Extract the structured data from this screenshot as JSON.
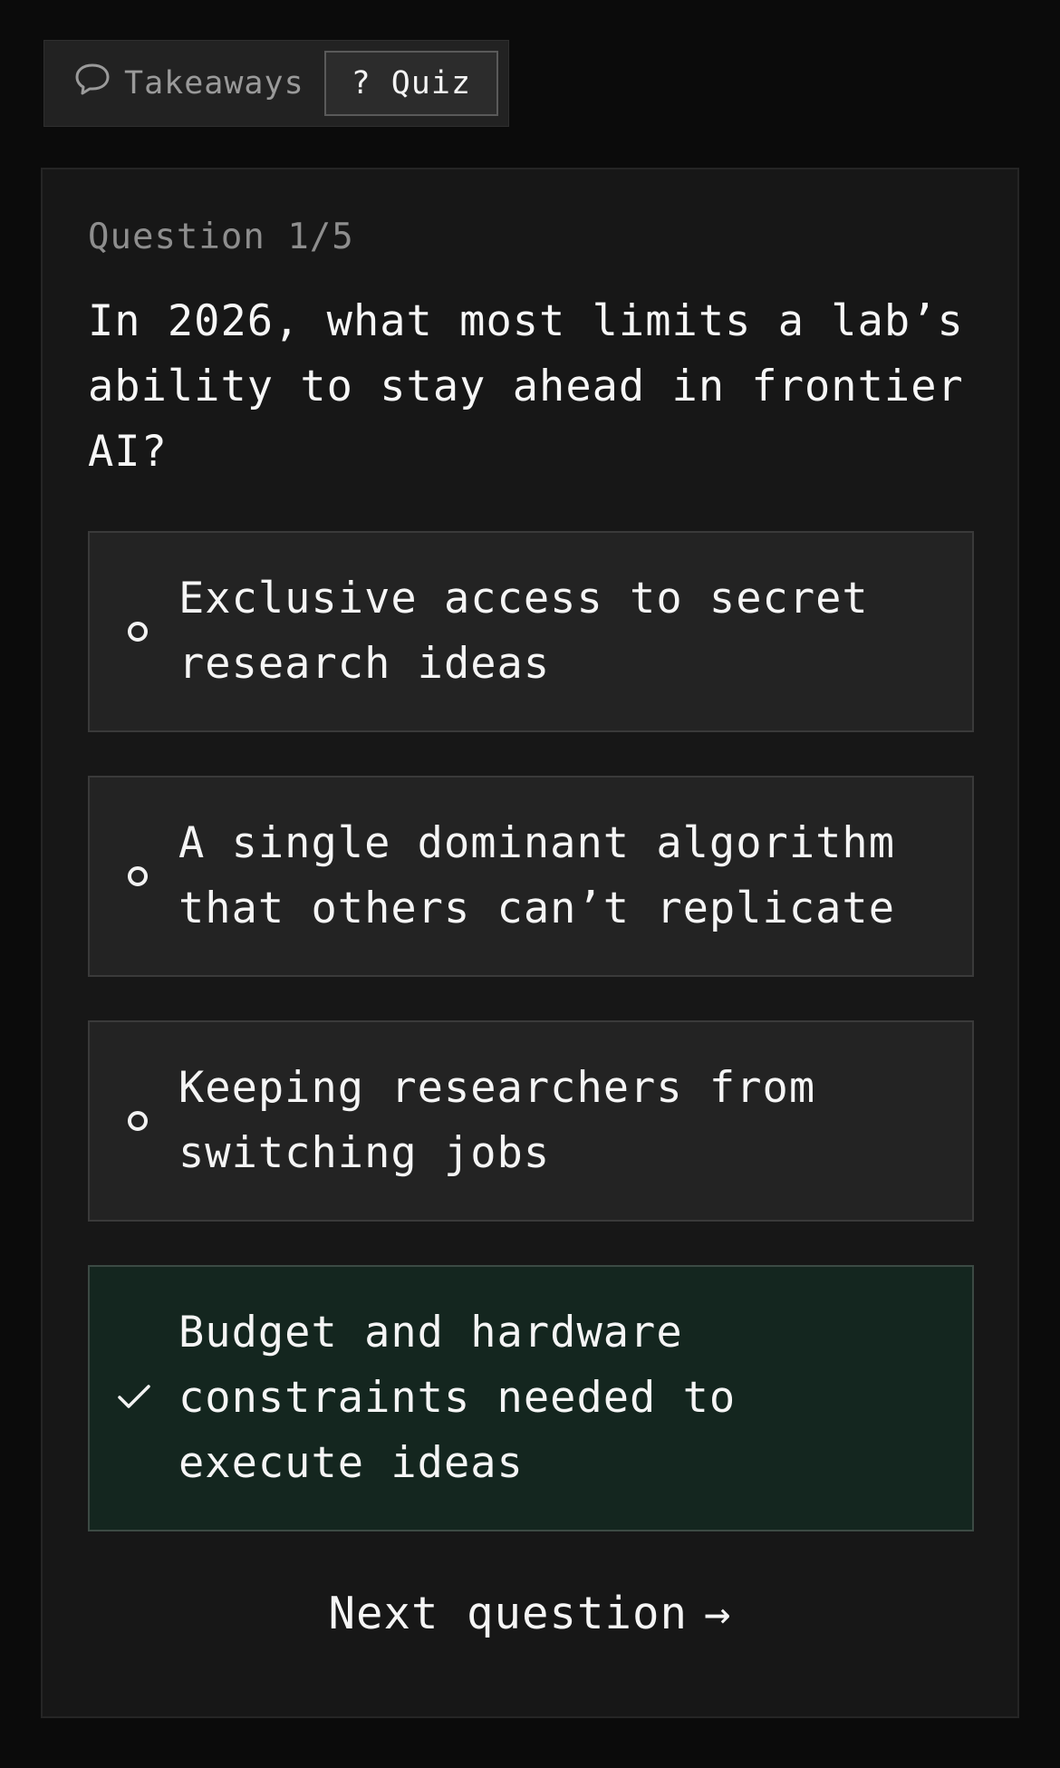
{
  "tabs": {
    "takeaways_label": "Takeaways",
    "quiz_label": "Quiz",
    "quiz_glyph": "?",
    "active": "Quiz"
  },
  "quiz": {
    "counter": "Question 1/5",
    "question": "In 2026, what most limits a lab’s ability to stay ahead in frontier AI?",
    "options": [
      {
        "text": "Exclusive access to secret research ideas",
        "state": "unselected"
      },
      {
        "text": "A single dominant algorithm that others can’t replicate",
        "state": "unselected"
      },
      {
        "text": "Keeping researchers from switching jobs",
        "state": "unselected"
      },
      {
        "text": "Budget and hardware constraints needed to execute ideas",
        "state": "correct"
      }
    ],
    "next_label": "Next question",
    "next_arrow": "→"
  },
  "colors": {
    "background": "#0b0b0b",
    "card": "#171717",
    "option": "#232323",
    "correct_option": "#14261f",
    "muted_text": "#8e8e8e",
    "text": "#f5f5f5"
  },
  "icons": {
    "takeaways": "speech-bubble-icon",
    "unselected_option": "radio-circle-icon",
    "correct_option": "checkmark-icon",
    "next": "arrow-right-icon"
  }
}
